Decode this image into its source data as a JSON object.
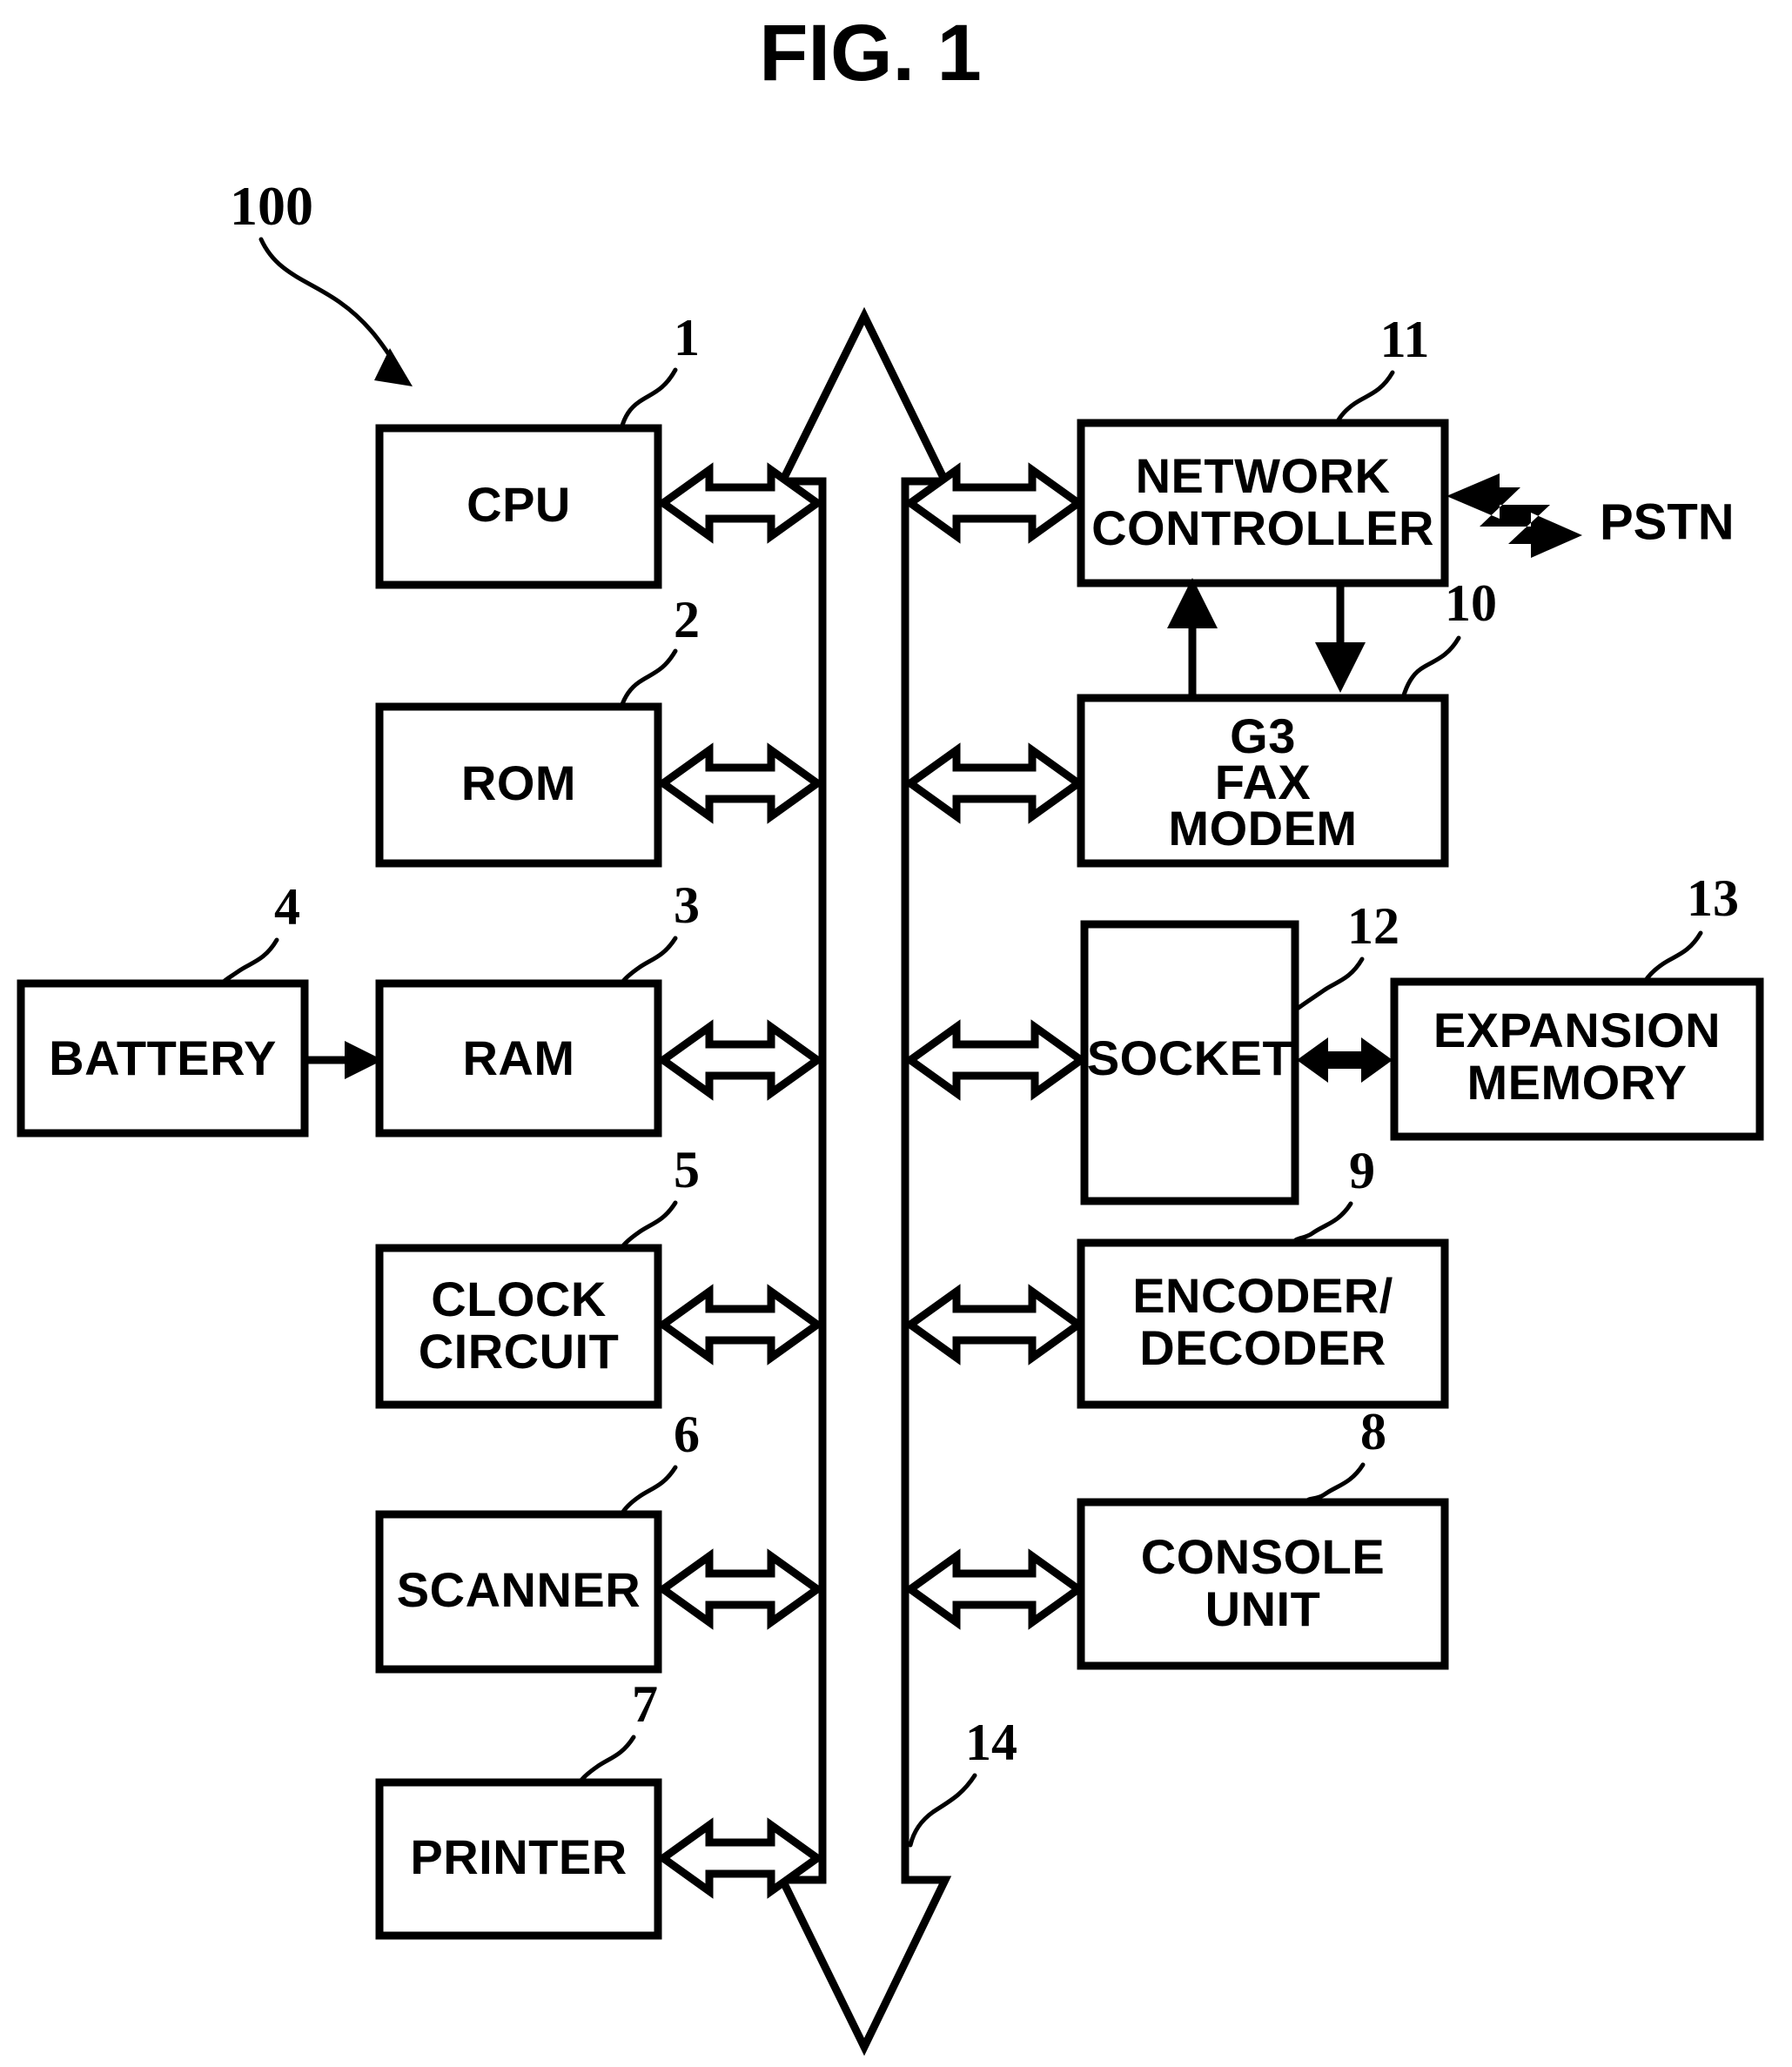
{
  "figure": {
    "title": "FIG. 1",
    "system_ref": "100",
    "bus_ref": "14"
  },
  "blocks": [
    {
      "id": "cpu",
      "label": "CPU",
      "ref": "1",
      "column": "left"
    },
    {
      "id": "rom",
      "label": "ROM",
      "ref": "2",
      "column": "left"
    },
    {
      "id": "ram",
      "label": "RAM",
      "ref": "3",
      "column": "left"
    },
    {
      "id": "battery",
      "label": "BATTERY",
      "ref": "4",
      "column": "far-left"
    },
    {
      "id": "clock-circuit",
      "label": "CLOCK CIRCUIT",
      "ref": "5",
      "column": "left",
      "line1": "CLOCK",
      "line2": "CIRCUIT"
    },
    {
      "id": "scanner",
      "label": "SCANNER",
      "ref": "6",
      "column": "left"
    },
    {
      "id": "printer",
      "label": "PRINTER",
      "ref": "7",
      "column": "left"
    },
    {
      "id": "console-unit",
      "label": "CONSOLE UNIT",
      "ref": "8",
      "column": "right",
      "line1": "CONSOLE",
      "line2": "UNIT"
    },
    {
      "id": "encoder-decoder",
      "label": "ENCODER/ DECODER",
      "ref": "9",
      "column": "right",
      "line1": "ENCODER/",
      "line2": "DECODER"
    },
    {
      "id": "g3-fax-modem",
      "label": "G3 FAX MODEM",
      "ref": "10",
      "column": "right",
      "line1": "G3",
      "line2": "FAX",
      "line3": "MODEM"
    },
    {
      "id": "network-controller",
      "label": "NETWORK CONTROLLER",
      "ref": "11",
      "column": "right",
      "line1": "NETWORK",
      "line2": "CONTROLLER"
    },
    {
      "id": "socket",
      "label": "SOCKET",
      "ref": "12",
      "column": "right"
    },
    {
      "id": "expansion-memory",
      "label": "EXPANSION MEMORY",
      "ref": "13",
      "column": "far-right",
      "line1": "EXPANSION",
      "line2": "MEMORY"
    }
  ],
  "external": {
    "pstn_label": "PSTN"
  },
  "colors": {
    "stroke": "#000000",
    "fill": "#ffffff",
    "background": "#ffffff"
  }
}
